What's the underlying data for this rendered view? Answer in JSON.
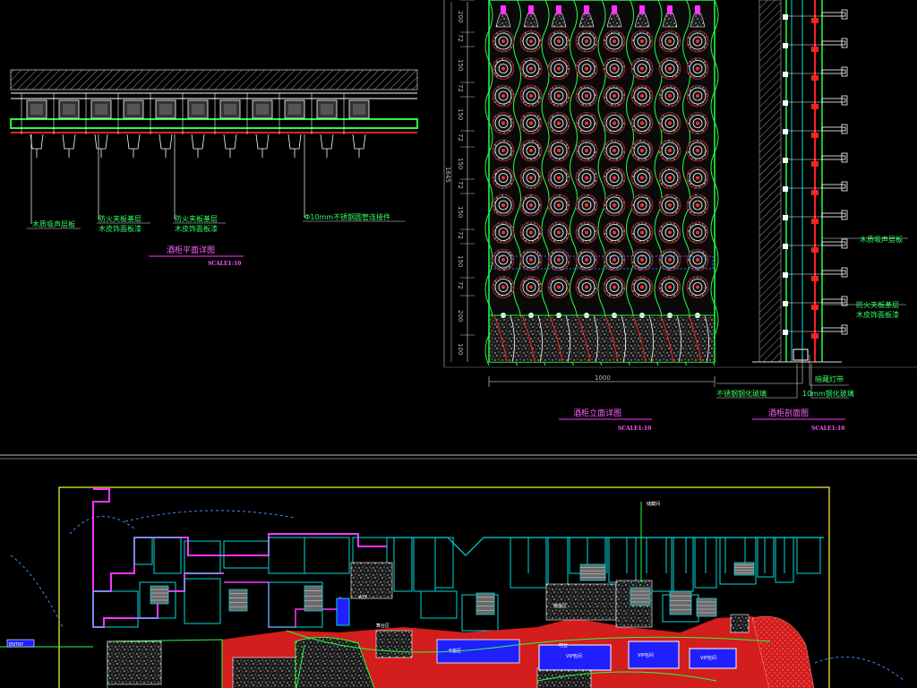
{
  "plan_detail": {
    "callouts": [
      "木质吸声层板",
      "防火夹板基层",
      "木皮饰面板漆",
      "防火夹板基层",
      "木皮饰面板漆",
      "Φ10mm不锈钢圆管连接件"
    ],
    "title": "酒柜平面详图",
    "scale": "SCALE1:10"
  },
  "elevation_detail": {
    "title": "酒柜立面详图",
    "scale": "SCALE1:10",
    "width_dim": "1000",
    "height_dim": "1645",
    "segment_dims": [
      "200",
      "72",
      "150",
      "72",
      "150",
      "72",
      "150",
      "72",
      "150",
      "72",
      "150",
      "72",
      "200",
      "100"
    ]
  },
  "section_detail": {
    "title": "酒柜剖面图",
    "scale": "SCALE1:10",
    "callouts": [
      "木质吸声层板",
      "防火夹板基层",
      "木皮饰面板漆",
      "暗藏灯带",
      "10mm钢化玻璃",
      "不锈钢钢化玻璃"
    ]
  },
  "floor_plan": {
    "tags": [
      "ENTRY",
      "VIP包间",
      "VIP包间",
      "VIP包间",
      "卡座区",
      "散座区",
      "大厅",
      "吧台",
      "舞台区",
      "储藏间"
    ]
  },
  "colors": {
    "background": "#000000",
    "lines_white": "#ffffff",
    "green": "#22ff44",
    "cyan": "#00d8d8",
    "magenta": "#ff33ff",
    "red": "#ff2020",
    "blue": "#2020ff"
  }
}
